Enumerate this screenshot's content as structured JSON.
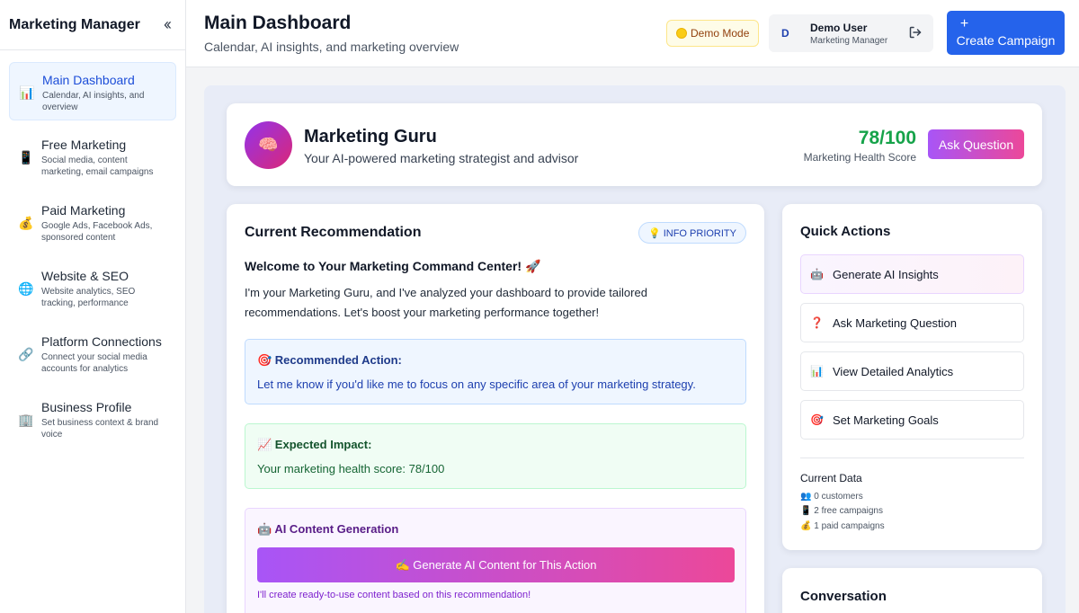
{
  "sidebar": {
    "brand": "Marketing Manager",
    "collapse_icon": "chevron-double-left-icon",
    "items": [
      {
        "label": "Main Dashboard",
        "desc": "Calendar, AI insights, and overview",
        "icon": "📊"
      },
      {
        "label": "Free Marketing",
        "desc": "Social media, content marketing, email campaigns",
        "icon": "📱"
      },
      {
        "label": "Paid Marketing",
        "desc": "Google Ads, Facebook Ads, sponsored content",
        "icon": "💰"
      },
      {
        "label": "Website & SEO",
        "desc": "Website analytics, SEO tracking, performance",
        "icon": "🌐"
      },
      {
        "label": "Platform Connections",
        "desc": "Connect your social media accounts for analytics",
        "icon": "🔗"
      },
      {
        "label": "Business Profile",
        "desc": "Set business context & brand voice",
        "icon": "🏢"
      }
    ]
  },
  "header": {
    "title": "Main Dashboard",
    "subtitle": "Calendar, AI insights, and marketing overview",
    "demo_mode": "Demo Mode",
    "user_initial": "D",
    "user_name": "Demo User",
    "user_role": "Marketing Manager",
    "create_label": "Create Campaign",
    "create_plus": "+"
  },
  "guru": {
    "icon": "🧠",
    "title": "Marketing Guru",
    "subtitle": "Your AI-powered marketing strategist and advisor",
    "score": "78/100",
    "score_label": "Marketing Health Score",
    "ask_label": "Ask Question"
  },
  "recommendation": {
    "title": "Current Recommendation",
    "priority": "💡 INFO PRIORITY",
    "welcome": "Welcome to Your Marketing Command Center! 🚀",
    "intro": "I'm your Marketing Guru, and I've analyzed your dashboard to provide tailored recommendations. Let's boost your marketing performance together!",
    "action_title": "🎯 Recommended Action:",
    "action_text": "Let me know if you'd like me to focus on any specific area of your marketing strategy.",
    "impact_title": "📈 Expected Impact:",
    "impact_text": "Your marketing health score: 78/100",
    "ai_title": "🤖 AI Content Generation",
    "ai_button": "✍️  Generate AI Content for This Action",
    "ai_note": "I'll create ready-to-use content based on this recommendation!"
  },
  "quick_actions": {
    "title": "Quick Actions",
    "items": [
      {
        "icon": "🤖",
        "label": "Generate AI Insights"
      },
      {
        "icon": "❓",
        "label": "Ask Marketing Question"
      },
      {
        "icon": "📊",
        "label": "View Detailed Analytics"
      },
      {
        "icon": "🎯",
        "label": "Set Marketing Goals"
      }
    ],
    "current_data_title": "Current Data",
    "current_data": [
      "👥 0 customers",
      "📱 2 free campaigns",
      "💰 1 paid campaigns"
    ]
  },
  "conversation": {
    "title": "Conversation"
  }
}
